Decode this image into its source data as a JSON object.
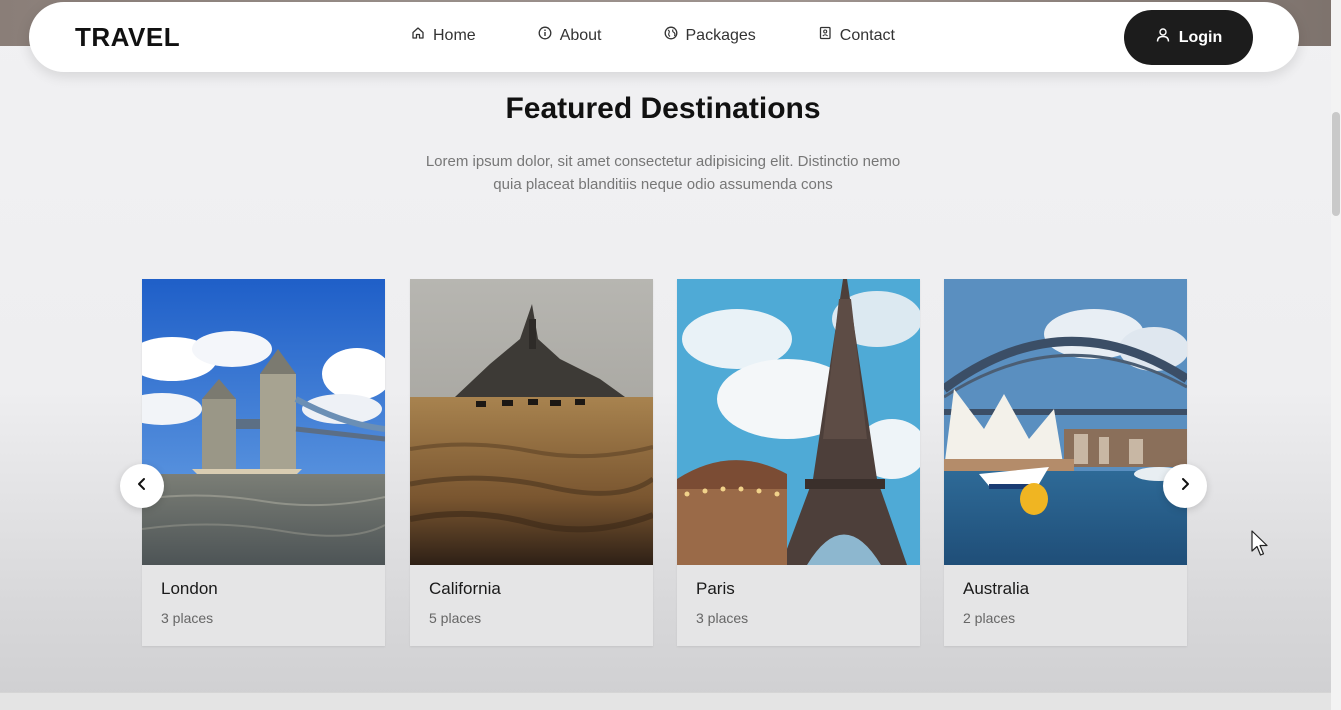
{
  "nav": {
    "logo": "TRAVEL",
    "links": [
      {
        "label": "Home",
        "icon": "home-icon"
      },
      {
        "label": "About",
        "icon": "info-icon"
      },
      {
        "label": "Packages",
        "icon": "globe-icon"
      },
      {
        "label": "Contact",
        "icon": "contact-book-icon"
      }
    ],
    "login_label": "Login"
  },
  "section": {
    "title": "Featured Destinations",
    "description": "Lorem ipsum dolor, sit amet consectetur adipisicing elit. Distinctio nemo quia placeat blanditiis neque odio assumenda cons"
  },
  "destinations": [
    {
      "city": "London",
      "places": "3 places"
    },
    {
      "city": "California",
      "places": "5 places"
    },
    {
      "city": "Paris",
      "places": "3 places"
    },
    {
      "city": "Australia",
      "places": "2 places"
    }
  ],
  "colors": {
    "accent": "#1c1c1c",
    "background": "#efeff1",
    "card": "#e5e5e6"
  }
}
